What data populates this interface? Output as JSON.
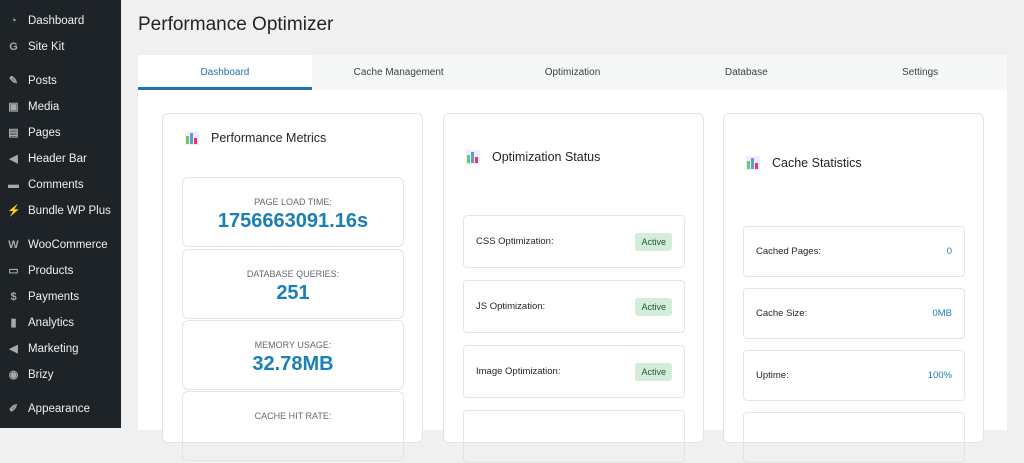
{
  "sidebar": {
    "items": [
      {
        "label": "Dashboard",
        "icon": "dashboard-icon",
        "g": "◔"
      },
      {
        "label": "Site Kit",
        "icon": "google-icon",
        "g": "G"
      },
      {
        "label": "Posts",
        "icon": "pin-icon",
        "g": "✎"
      },
      {
        "label": "Media",
        "icon": "media-icon",
        "g": "▣"
      },
      {
        "label": "Pages",
        "icon": "pages-icon",
        "g": "▤"
      },
      {
        "label": "Header Bar",
        "icon": "megaphone-icon",
        "g": "◀"
      },
      {
        "label": "Comments",
        "icon": "comment-icon",
        "g": "▬"
      },
      {
        "label": "Bundle WP Plus",
        "icon": "plugin-icon",
        "g": "⚡"
      },
      {
        "label": "WooCommerce",
        "icon": "woo-icon",
        "g": "W"
      },
      {
        "label": "Products",
        "icon": "archive-icon",
        "g": "▭"
      },
      {
        "label": "Payments",
        "icon": "payments-icon",
        "g": "$"
      },
      {
        "label": "Analytics",
        "icon": "bar-chart-icon",
        "g": "▮"
      },
      {
        "label": "Marketing",
        "icon": "megaphone-icon",
        "g": "◀"
      },
      {
        "label": "Brizy",
        "icon": "brizy-icon",
        "g": "◉"
      },
      {
        "label": "Appearance",
        "icon": "brush-icon",
        "g": "✐"
      }
    ]
  },
  "title": "Performance Optimizer",
  "tabs": [
    "Dashboard",
    "Cache Management",
    "Optimization",
    "Database",
    "Settings"
  ],
  "metrics": {
    "title": "Performance Metrics",
    "items": [
      {
        "label": "PAGE LOAD TIME:",
        "value": "1756663091.16s"
      },
      {
        "label": "DATABASE QUERIES:",
        "value": "251"
      },
      {
        "label": "MEMORY USAGE:",
        "value": "32.78MB"
      },
      {
        "label": "CACHE HIT RATE:",
        "value": ""
      }
    ]
  },
  "optimization": {
    "title": "Optimization Status",
    "items": [
      {
        "label": "CSS Optimization:",
        "status": "Active"
      },
      {
        "label": "JS Optimization:",
        "status": "Active"
      },
      {
        "label": "Image Optimization:",
        "status": "Active"
      },
      {
        "label": "",
        "status": ""
      }
    ]
  },
  "cache": {
    "title": "Cache Statistics",
    "items": [
      {
        "label": "Cached Pages:",
        "value": "0"
      },
      {
        "label": "Cache Size:",
        "value": "0MB"
      },
      {
        "label": "Uptime:",
        "value": "100%"
      },
      {
        "label": "",
        "value": ""
      }
    ]
  }
}
